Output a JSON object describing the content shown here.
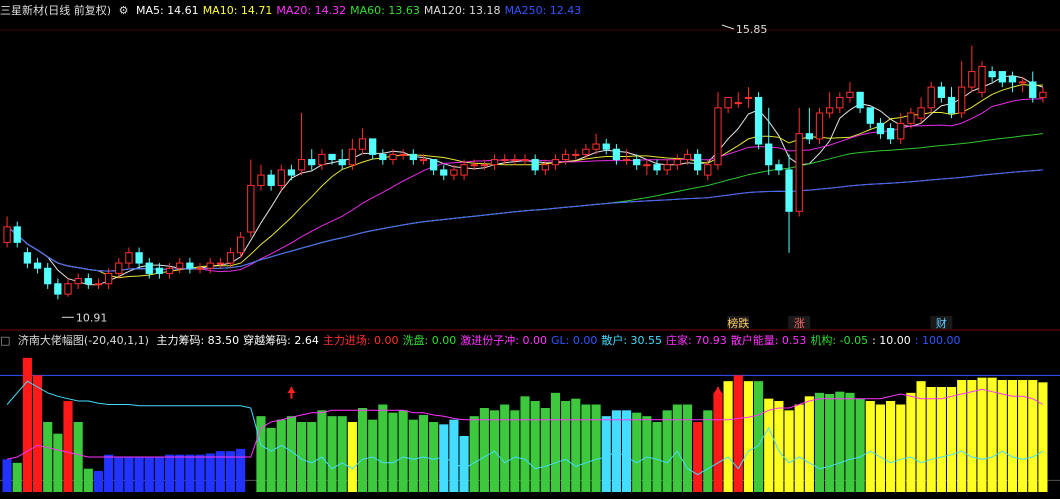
{
  "header": {
    "title": "三星新材(日线 前复权)",
    "ma": [
      {
        "label": "MA5: 14.61",
        "color": "#ffffff"
      },
      {
        "label": "MA10: 14.71",
        "color": "#ffff3c"
      },
      {
        "label": "MA20: 14.32",
        "color": "#ff33ff"
      },
      {
        "label": "MA60: 13.63",
        "color": "#33dd33"
      },
      {
        "label": "MA120: 13.18",
        "color": "#dddddd"
      },
      {
        "label": "MA250: 12.43",
        "color": "#3355ff"
      }
    ]
  },
  "sub_header": {
    "title": "济南大佬幅图(-20,40,1,1)",
    "items": [
      {
        "label": "主力筹码: 83.50",
        "color": "#ffffff"
      },
      {
        "label": "穿越筹码: 2.64",
        "color": "#ffffff"
      },
      {
        "label": "主力进场: 0.00",
        "color": "#ff3030"
      },
      {
        "label": "洗盘: 0.00",
        "color": "#33dd33"
      },
      {
        "label": "激进份子冲: 0.00",
        "color": "#ff33ff"
      },
      {
        "label": "GL: 0.00",
        "color": "#3355ff"
      },
      {
        "label": "散户: 30.55",
        "color": "#44ddff"
      },
      {
        "label": "庄家: 70.93",
        "color": "#ff33ff"
      },
      {
        "label": "散户能量: 0.53",
        "color": "#ff33ff"
      },
      {
        "label": "机构: -0.05",
        "color": "#33dd33"
      },
      {
        "label": ": 10.00",
        "color": "#ffffff"
      },
      {
        "label": ": 100.00",
        "color": "#3355ff"
      }
    ]
  },
  "annotations": {
    "high": "15.85",
    "low": "10.91",
    "events": [
      "榜跌",
      "涨",
      "财"
    ]
  },
  "chart_data": [
    {
      "type": "candlestick",
      "title": "三星新材(日线 前复权)",
      "ylim": [
        10.5,
        16.2
      ],
      "x": [
        1,
        2,
        3,
        4,
        5,
        6,
        7,
        8,
        9,
        10,
        11,
        12,
        13,
        14,
        15,
        16,
        17,
        18,
        19,
        20,
        21,
        22,
        23,
        24,
        25,
        26,
        27,
        28,
        29,
        30,
        31,
        32,
        33,
        34,
        35,
        36,
        37,
        38,
        39,
        40,
        41,
        42,
        43,
        44,
        45,
        46,
        47,
        48,
        49,
        50,
        51,
        52,
        53,
        54,
        55,
        56,
        57,
        58,
        59,
        60,
        61,
        62,
        63,
        64,
        65,
        66,
        67,
        68,
        69,
        70,
        71,
        72,
        73,
        74,
        75,
        76,
        77,
        78,
        79,
        80,
        81,
        82,
        83,
        84,
        85,
        86,
        87,
        88,
        89,
        90,
        91,
        92,
        93,
        94,
        95,
        96,
        97,
        98,
        99,
        100,
        101,
        102,
        103
      ],
      "open": [
        12.0,
        12.3,
        11.8,
        11.6,
        11.5,
        11.2,
        11.0,
        11.2,
        11.3,
        11.2,
        11.2,
        11.4,
        11.6,
        11.8,
        11.6,
        11.5,
        11.4,
        11.5,
        11.6,
        11.5,
        11.5,
        11.6,
        11.6,
        11.8,
        12.2,
        13.1,
        13.3,
        13.1,
        13.4,
        13.4,
        13.6,
        13.5,
        13.7,
        13.6,
        13.5,
        13.8,
        14.0,
        13.7,
        13.6,
        13.7,
        13.7,
        13.6,
        13.6,
        13.4,
        13.3,
        13.3,
        13.5,
        13.5,
        13.5,
        13.6,
        13.6,
        13.6,
        13.6,
        13.4,
        13.5,
        13.6,
        13.7,
        13.7,
        13.8,
        13.9,
        13.8,
        13.6,
        13.6,
        13.5,
        13.5,
        13.4,
        13.5,
        13.6,
        13.7,
        13.3,
        13.5,
        14.6,
        14.7,
        14.8,
        14.8,
        13.9,
        13.5,
        13.4,
        12.6,
        14.1,
        14.0,
        14.5,
        14.6,
        14.8,
        14.9,
        14.6,
        14.3,
        14.2,
        14.0,
        14.3,
        14.4,
        14.6,
        15.0,
        14.8,
        14.5,
        15.0,
        14.9,
        15.3,
        15.3,
        15.2,
        15.1,
        15.1,
        14.8
      ],
      "close": [
        12.3,
        12.0,
        11.6,
        11.5,
        11.2,
        11.0,
        11.2,
        11.3,
        11.2,
        11.2,
        11.4,
        11.6,
        11.8,
        11.6,
        11.4,
        11.4,
        11.5,
        11.6,
        11.5,
        11.5,
        11.6,
        11.6,
        11.8,
        12.1,
        13.1,
        13.3,
        13.1,
        13.4,
        13.3,
        13.6,
        13.5,
        13.7,
        13.6,
        13.5,
        13.8,
        14.0,
        13.7,
        13.6,
        13.7,
        13.7,
        13.6,
        13.6,
        13.4,
        13.3,
        13.4,
        13.5,
        13.5,
        13.5,
        13.6,
        13.6,
        13.6,
        13.6,
        13.4,
        13.5,
        13.6,
        13.7,
        13.7,
        13.8,
        13.9,
        13.8,
        13.6,
        13.6,
        13.5,
        13.5,
        13.4,
        13.5,
        13.6,
        13.7,
        13.4,
        13.5,
        14.6,
        14.8,
        14.7,
        14.8,
        13.9,
        13.5,
        13.4,
        12.6,
        14.1,
        14.0,
        14.5,
        14.6,
        14.8,
        14.9,
        14.6,
        14.3,
        14.1,
        14.0,
        14.3,
        14.5,
        14.6,
        15.0,
        14.8,
        14.5,
        15.0,
        15.3,
        15.4,
        15.2,
        15.1,
        15.1,
        15.1,
        14.8,
        14.9
      ],
      "high": [
        12.5,
        12.4,
        11.9,
        11.7,
        11.6,
        11.3,
        11.3,
        11.4,
        11.4,
        11.3,
        11.5,
        11.7,
        11.9,
        11.9,
        11.7,
        11.6,
        11.6,
        11.7,
        11.7,
        11.6,
        11.7,
        11.7,
        11.9,
        12.2,
        13.6,
        13.5,
        13.4,
        13.5,
        13.5,
        14.5,
        13.8,
        13.8,
        13.7,
        13.8,
        14.0,
        14.2,
        13.9,
        13.8,
        13.8,
        13.8,
        13.8,
        13.7,
        13.6,
        13.5,
        13.5,
        13.6,
        13.6,
        13.6,
        13.7,
        13.7,
        13.7,
        13.7,
        13.7,
        13.6,
        13.7,
        13.8,
        13.8,
        13.9,
        14.1,
        14.0,
        13.9,
        13.8,
        13.7,
        13.6,
        13.6,
        13.6,
        13.7,
        13.8,
        13.8,
        13.6,
        14.9,
        14.8,
        14.9,
        15.0,
        14.9,
        14.6,
        13.6,
        13.7,
        14.6,
        14.6,
        14.6,
        14.9,
        14.9,
        15.1,
        14.9,
        14.6,
        14.4,
        14.3,
        14.5,
        14.6,
        14.8,
        15.1,
        15.1,
        15.0,
        15.5,
        15.8,
        15.5,
        15.4,
        15.3,
        15.3,
        15.2,
        15.3,
        15.0
      ],
      "low": [
        11.9,
        11.9,
        11.5,
        11.4,
        11.1,
        10.9,
        10.95,
        11.1,
        11.1,
        11.1,
        11.1,
        11.3,
        11.5,
        11.5,
        11.3,
        11.3,
        11.3,
        11.4,
        11.4,
        11.4,
        11.4,
        11.5,
        11.5,
        11.7,
        12.1,
        13.0,
        13.0,
        13.0,
        13.2,
        13.3,
        13.4,
        13.4,
        13.5,
        13.4,
        13.4,
        13.7,
        13.6,
        13.5,
        13.5,
        13.6,
        13.5,
        13.5,
        13.3,
        13.2,
        13.2,
        13.2,
        13.4,
        13.4,
        13.4,
        13.5,
        13.5,
        13.5,
        13.3,
        13.3,
        13.4,
        13.5,
        13.6,
        13.6,
        13.7,
        13.7,
        13.5,
        13.5,
        13.4,
        13.3,
        13.3,
        13.3,
        13.4,
        13.5,
        13.3,
        13.2,
        13.4,
        14.5,
        14.6,
        14.6,
        13.8,
        13.3,
        13.3,
        11.8,
        12.5,
        13.9,
        13.9,
        14.4,
        14.5,
        14.7,
        14.5,
        14.2,
        14.0,
        13.9,
        13.9,
        14.2,
        14.3,
        14.5,
        14.7,
        14.4,
        14.4,
        14.9,
        14.8,
        15.1,
        15.0,
        14.9,
        14.9,
        14.7,
        14.7
      ]
    },
    {
      "type": "bar",
      "title": "济南大佬幅图(-20,40,1,1)",
      "ylim": [
        0,
        120
      ],
      "x": [
        1,
        2,
        3,
        4,
        5,
        6,
        7,
        8,
        9,
        10,
        11,
        12,
        13,
        14,
        15,
        16,
        17,
        18,
        19,
        20,
        21,
        22,
        23,
        24,
        25,
        26,
        27,
        28,
        29,
        30,
        31,
        32,
        33,
        34,
        35,
        36,
        37,
        38,
        39,
        40,
        41,
        42,
        43,
        44,
        45,
        46,
        47,
        48,
        49,
        50,
        51,
        52,
        53,
        54,
        55,
        56,
        57,
        58,
        59,
        60,
        61,
        62,
        63,
        64,
        65,
        66,
        67,
        68,
        69,
        70,
        71,
        72,
        73,
        74,
        75,
        76,
        77,
        78,
        79,
        80,
        81,
        82,
        83,
        84,
        85,
        86,
        87,
        88,
        89,
        90,
        91,
        92,
        93,
        94,
        95,
        96,
        97,
        98,
        99,
        100,
        101,
        102,
        103
      ],
      "values": [
        28,
        25,
        115,
        100,
        60,
        50,
        78,
        60,
        20,
        18,
        32,
        30,
        30,
        30,
        30,
        30,
        32,
        32,
        32,
        32,
        33,
        35,
        35,
        37,
        0,
        65,
        55,
        62,
        65,
        60,
        60,
        70,
        65,
        65,
        60,
        72,
        62,
        75,
        68,
        70,
        62,
        66,
        60,
        58,
        62,
        48,
        65,
        72,
        70,
        75,
        70,
        82,
        78,
        72,
        85,
        78,
        80,
        75,
        75,
        65,
        70,
        70,
        68,
        65,
        60,
        70,
        75,
        75,
        60,
        70,
        85,
        95,
        100,
        95,
        95,
        80,
        78,
        70,
        75,
        82,
        85,
        84,
        86,
        85,
        80,
        78,
        75,
        78,
        75,
        85,
        95,
        90,
        90,
        90,
        96,
        96,
        98,
        98,
        96,
        96,
        96,
        96,
        94
      ],
      "colors": [
        "blue",
        "green",
        "red",
        "red",
        "green",
        "green",
        "red",
        "green",
        "green",
        "blue",
        "blue",
        "blue",
        "blue",
        "blue",
        "blue",
        "blue",
        "blue",
        "blue",
        "blue",
        "blue",
        "blue",
        "blue",
        "blue",
        "blue",
        "magenta",
        "green",
        "green",
        "green",
        "green",
        "green",
        "green",
        "green",
        "green",
        "green",
        "yellow",
        "green",
        "green",
        "green",
        "green",
        "green",
        "green",
        "green",
        "green",
        "cyan",
        "cyan",
        "cyan",
        "green",
        "green",
        "green",
        "green",
        "green",
        "green",
        "green",
        "green",
        "green",
        "green",
        "green",
        "green",
        "green",
        "cyan",
        "cyan",
        "cyan",
        "green",
        "green",
        "green",
        "green",
        "green",
        "green",
        "red",
        "green",
        "red",
        "yellow",
        "red",
        "yellow",
        "green",
        "yellow",
        "yellow",
        "yellow",
        "yellow",
        "yellow",
        "green",
        "green",
        "green",
        "green",
        "green",
        "yellow",
        "yellow",
        "yellow",
        "yellow",
        "yellow",
        "yellow",
        "yellow",
        "yellow",
        "yellow",
        "yellow",
        "yellow",
        "yellow",
        "yellow",
        "yellow",
        "yellow",
        "yellow",
        "yellow",
        "yellow"
      ],
      "series": [
        {
          "name": "散户",
          "color": "#44ddff",
          "values": [
            75,
            85,
            95,
            90,
            85,
            82,
            80,
            78,
            78,
            76,
            75,
            75,
            75,
            74,
            74,
            74,
            74,
            74,
            74,
            74,
            74,
            74,
            74,
            74,
            72,
            40,
            35,
            40,
            35,
            28,
            25,
            30,
            20,
            25,
            20,
            28,
            30,
            25,
            25,
            30,
            28,
            30,
            28,
            30,
            25,
            20,
            25,
            30,
            35,
            25,
            30,
            28,
            20,
            22,
            25,
            28,
            22,
            25,
            28,
            30,
            35,
            30,
            25,
            30,
            28,
            25,
            35,
            20,
            15,
            20,
            25,
            30,
            20,
            35,
            40,
            55,
            35,
            25,
            30,
            25,
            20,
            22,
            25,
            28,
            30,
            35,
            30,
            25,
            28,
            30,
            25,
            28,
            30,
            32,
            35,
            30,
            28,
            30,
            35,
            30,
            28,
            30,
            35
          ]
        },
        {
          "name": "庄家",
          "color": "#ff33ff",
          "values": [
            28,
            30,
            35,
            40,
            38,
            36,
            34,
            32,
            30,
            30,
            30,
            30,
            30,
            30,
            30,
            30,
            30,
            30,
            30,
            30,
            30,
            30,
            30,
            30,
            30,
            55,
            60,
            62,
            64,
            66,
            68,
            68,
            70,
            70,
            70,
            70,
            70,
            70,
            70,
            70,
            68,
            68,
            66,
            65,
            63,
            62,
            62,
            62,
            62,
            62,
            62,
            62,
            62,
            62,
            62,
            62,
            62,
            62,
            62,
            62,
            62,
            62,
            62,
            62,
            62,
            62,
            62,
            62,
            62,
            62,
            62,
            62,
            63,
            64,
            66,
            70,
            72,
            72,
            75,
            78,
            80,
            80,
            80,
            80,
            80,
            80,
            80,
            82,
            84,
            82,
            80,
            80,
            80,
            82,
            84,
            86,
            88,
            86,
            84,
            82,
            82,
            80,
            75
          ]
        }
      ]
    }
  ]
}
